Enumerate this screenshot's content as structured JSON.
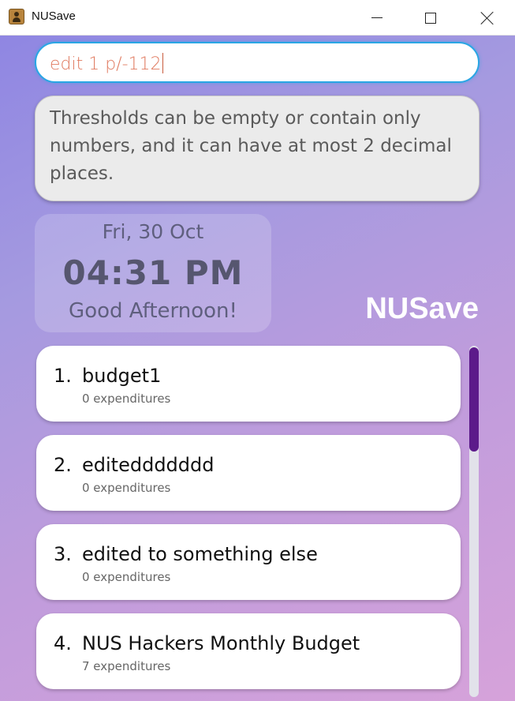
{
  "window": {
    "title": "NUSave",
    "app_icon": "address-book-icon",
    "controls": [
      "minimize-icon",
      "maximize-icon",
      "close-icon"
    ]
  },
  "command": {
    "value": "edit 1 p/-112"
  },
  "result": {
    "message": "Thresholds can be empty or contain only numbers, and it can have at most 2 decimal places."
  },
  "clock": {
    "date": "Fri, 30 Oct",
    "time": "04:31 PM",
    "greeting": "Good Afternoon!"
  },
  "brand": {
    "name": "NUSave"
  },
  "budgets": [
    {
      "index": "1.",
      "name": "budget1",
      "expenditures": "0 expenditures"
    },
    {
      "index": "2.",
      "name": "editeddddddd",
      "expenditures": "0 expenditures"
    },
    {
      "index": "3.",
      "name": "edited to something else",
      "expenditures": "0 expenditures"
    },
    {
      "index": "4.",
      "name": "NUS Hackers Monthly Budget",
      "expenditures": "7 expenditures"
    }
  ],
  "colors": {
    "command_border": "#29a6e4",
    "command_text": "#e07a5f",
    "scrollbar_thumb": "#5c1a8a",
    "background_start": "#8f86e2",
    "background_end": "#d6a2da"
  }
}
